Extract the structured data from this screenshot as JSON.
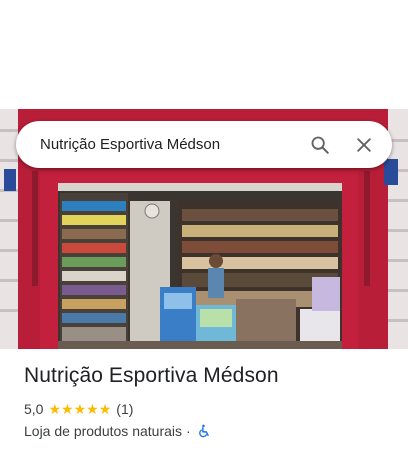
{
  "search": {
    "query": "Nutrição Esportiva Médson",
    "search_icon": "search-icon",
    "close_icon": "close-icon"
  },
  "place": {
    "name": "Nutrição Esportiva Médson",
    "rating": "5,0",
    "stars": 5,
    "review_count": "(1)",
    "category": "Loja de produtos naturais",
    "separator": "·",
    "accessibility_icon": "wheelchair-icon"
  },
  "colors": {
    "star": "#fbbc04",
    "accessibility": "#1a73e8",
    "storefront": "#b81e38"
  }
}
